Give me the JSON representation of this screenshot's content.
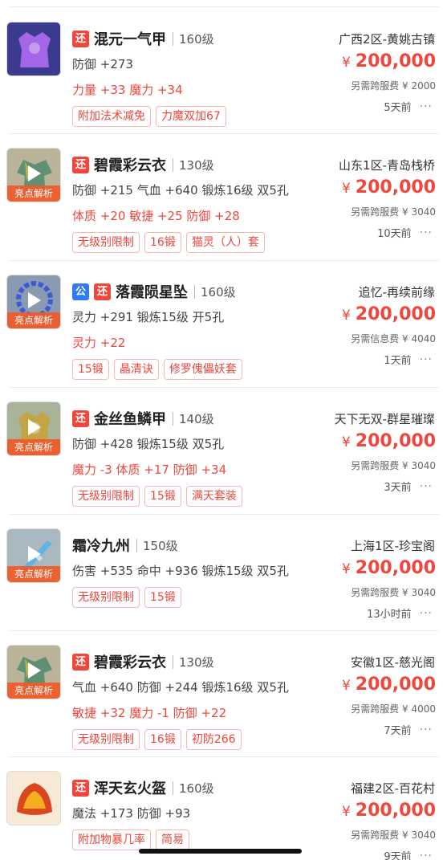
{
  "listings": [
    {
      "tags": [
        "还"
      ],
      "name": "混元一气甲",
      "level": "160级",
      "attrs": "防御 +273",
      "red_attrs": "力量 +33 魔力 +34",
      "chips": [
        "附加法术减免",
        "力魔双加67"
      ],
      "server": "广西2区-黄姚古镇",
      "price_symbol": "¥",
      "price": "200,000",
      "fee": "另需跨服费 ¥ 2000",
      "time": "5天前",
      "more": "···",
      "has_video": false,
      "image_icon": "armor-purple-icon",
      "colors": {
        "bg": "#3a3b8f",
        "fg": "#b06cf0"
      }
    },
    {
      "tags": [
        "还"
      ],
      "name": "碧霞彩云衣",
      "level": "130级",
      "attrs": "防御 +215 气血 +640 锻炼16级 双5孔",
      "red_attrs": "体质 +20 敏捷 +25 防御 +28",
      "chips": [
        "无级别限制",
        "16锻",
        "猫灵（人）套"
      ],
      "server": "山东1区-青岛栈桥",
      "price_symbol": "¥",
      "price": "200,000",
      "fee": "另需跨服费 ¥ 3040",
      "time": "10天前",
      "more": "···",
      "has_video": true,
      "ribbon": "亮点解析",
      "image_icon": "robe-green-icon",
      "colors": {
        "bg": "#b9b39a",
        "fg": "#4f8a6c"
      }
    },
    {
      "tags": [
        "公",
        "还"
      ],
      "name": "落霞陨星坠",
      "level": "160级",
      "attrs": "灵力 +291 锻炼15级 开5孔",
      "red_attrs": "灵力 +22",
      "chips": [
        "15锻",
        "晶清诀",
        "修罗傀儡妖套"
      ],
      "server": "追忆-再续前缘",
      "price_symbol": "¥",
      "price": "200,000",
      "fee": "另需信息费 ¥ 4040",
      "time": "1天前",
      "more": "···",
      "has_video": true,
      "ribbon": "亮点解析",
      "image_icon": "necklace-blue-icon",
      "colors": {
        "bg": "#8a9ab0",
        "fg": "#3b5bd6"
      }
    },
    {
      "tags": [
        "还"
      ],
      "name": "金丝鱼鳞甲",
      "level": "140级",
      "attrs": "防御 +428 锻炼15级 双5孔",
      "red_attrs": "魔力 -3 体质 +17 防御 +34",
      "chips": [
        "无级别限制",
        "15锻",
        "满天套装"
      ],
      "server": "天下无双-群星璀璨",
      "price_symbol": "¥",
      "price": "200,000",
      "fee": "另需跨服费 ¥ 3040",
      "time": "3天前",
      "more": "···",
      "has_video": true,
      "ribbon": "亮点解析",
      "image_icon": "armor-gold-icon",
      "colors": {
        "bg": "#a9b39a",
        "fg": "#c8a23c"
      }
    },
    {
      "tags": [],
      "name": "霜冷九州",
      "level": "150级",
      "attrs": "伤害 +535 命中 +936 锻炼15级 双5孔",
      "red_attrs": "",
      "chips": [
        "无级别限制",
        "15锻"
      ],
      "server": "上海1区-珍宝阁",
      "price_symbol": "¥",
      "price": "200,000",
      "fee": "另需跨服费 ¥ 3040",
      "time": "13小时前",
      "more": "···",
      "has_video": true,
      "ribbon": "亮点解析",
      "image_icon": "sword-ice-icon",
      "colors": {
        "bg": "#aab8c2",
        "fg": "#5fb4e6"
      }
    },
    {
      "tags": [
        "还"
      ],
      "name": "碧霞彩云衣",
      "level": "130级",
      "attrs": "气血 +640 防御 +244 锻炼16级 双5孔",
      "red_attrs": "敏捷 +32 魔力 -1 防御 +22",
      "chips": [
        "无级别限制",
        "16锻",
        "初防266"
      ],
      "server": "安徽1区-慈光阁",
      "price_symbol": "¥",
      "price": "200,000",
      "fee": "另需跨服费 ¥ 4000",
      "time": "7天前",
      "more": "···",
      "has_video": true,
      "ribbon": "亮点解析",
      "image_icon": "robe-green-icon",
      "colors": {
        "bg": "#b9b39a",
        "fg": "#4f8a6c"
      }
    },
    {
      "tags": [
        "还"
      ],
      "name": "浑天玄火盔",
      "level": "160级",
      "attrs": "魔法 +173 防御 +93",
      "red_attrs": "",
      "chips": [
        "附加物暴几率",
        "简易"
      ],
      "server": "福建2区-百花村",
      "price_symbol": "¥",
      "price": "200,000",
      "fee": "另需跨服费 ¥ 3040",
      "time": "9天前",
      "more": "···",
      "has_video": false,
      "image_icon": "helmet-fire-icon",
      "colors": {
        "bg": "#f6e9d6",
        "fg": "#d9461f"
      }
    }
  ]
}
